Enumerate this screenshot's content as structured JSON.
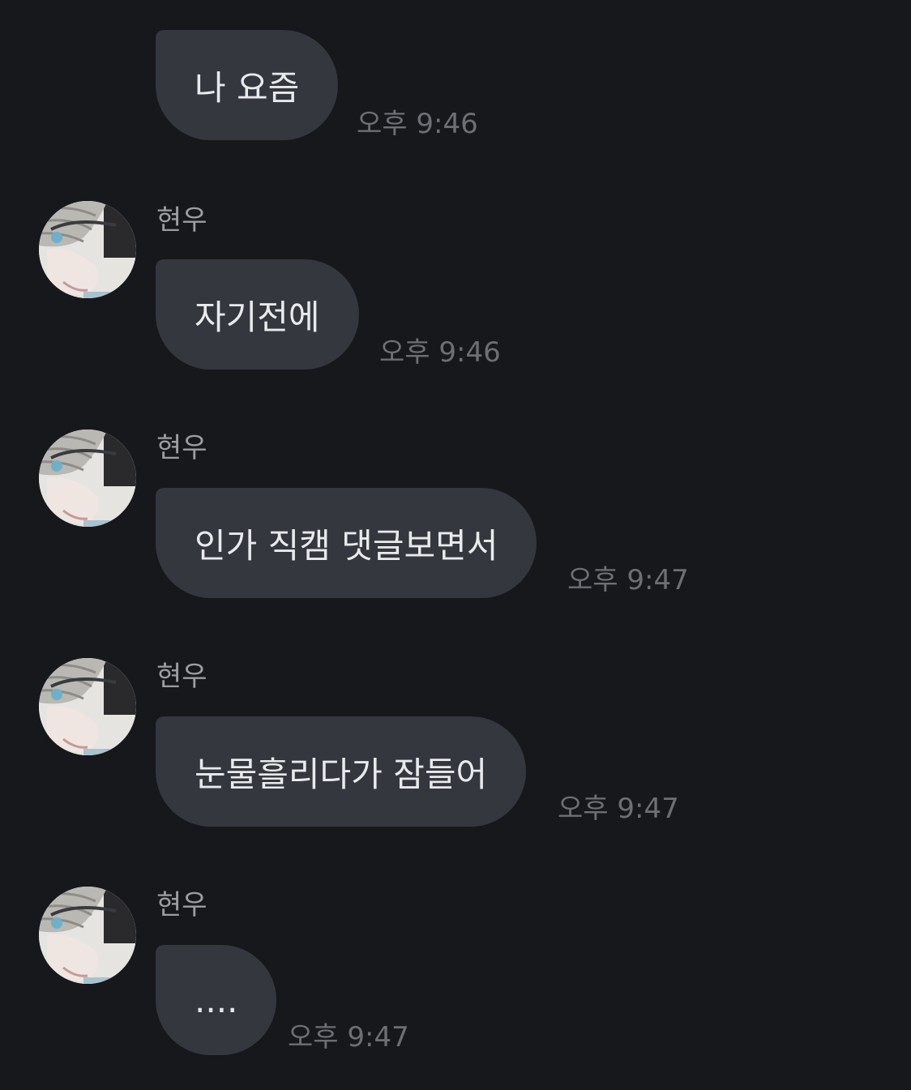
{
  "colors": {
    "background": "#17181c",
    "bubble": "#34373e",
    "message_text": "#e9eaec",
    "sender_text": "#9c9ea3",
    "time_text": "#6d6f75"
  },
  "messages": [
    {
      "sender": "",
      "avatar": false,
      "text": "나 요즘",
      "time": "오후 9:46"
    },
    {
      "sender": "현우",
      "avatar": true,
      "text": "자기전에",
      "time": "오후 9:46"
    },
    {
      "sender": "현우",
      "avatar": true,
      "text": "인가 직캠 댓글보면서",
      "time": "오후 9:47"
    },
    {
      "sender": "현우",
      "avatar": true,
      "text": "눈물흘리다가 잠들어",
      "time": "오후 9:47"
    },
    {
      "sender": "현우",
      "avatar": true,
      "text": "....",
      "time": "오후 9:47"
    }
  ]
}
